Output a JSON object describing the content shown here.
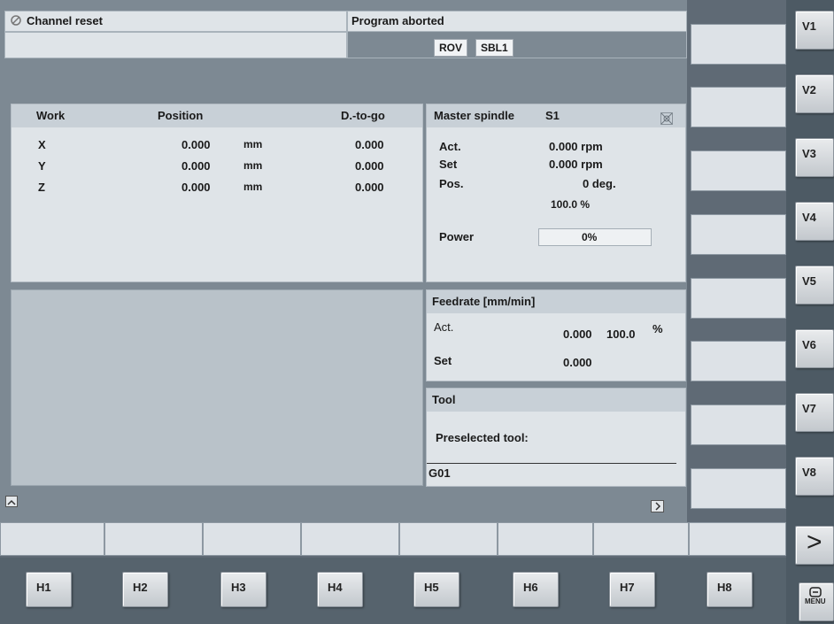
{
  "header": {
    "status": "Channel reset",
    "program_status": "Program aborted",
    "chips": [
      "ROV",
      "SBL1"
    ]
  },
  "work": {
    "headers": [
      "Work",
      "Position",
      "D.-to-go"
    ],
    "rows": [
      {
        "axis": "X",
        "pos": "0.000",
        "unit": "mm",
        "dtg": "0.000"
      },
      {
        "axis": "Y",
        "pos": "0.000",
        "unit": "mm",
        "dtg": "0.000"
      },
      {
        "axis": "Z",
        "pos": "0.000",
        "unit": "mm",
        "dtg": "0.000"
      }
    ]
  },
  "spindle": {
    "title": "Master spindle",
    "name": "S1",
    "act_label": "Act.",
    "act_value": "0.000 rpm",
    "set_label": "Set",
    "set_value": "0.000 rpm",
    "pos_label": "Pos.",
    "pos_value": "0 deg.",
    "override": "100.0 %",
    "power_label": "Power",
    "power_value": "0%"
  },
  "feed": {
    "title": "Feedrate [mm/min]",
    "act_label": "Act.",
    "act_value": "0.000",
    "act_override": "100.0",
    "percent": "%",
    "set_label": "Set",
    "set_value": "0.000"
  },
  "tool": {
    "title": "Tool",
    "preselected_label": "Preselected tool:",
    "gcode": "G01"
  },
  "keys": {
    "horizontal": [
      "H1",
      "H2",
      "H3",
      "H4",
      "H5",
      "H6",
      "H7",
      "H8"
    ],
    "vertical": [
      "V1",
      "V2",
      "V3",
      "V4",
      "V5",
      "V6",
      "V7",
      "V8"
    ],
    "next": ">",
    "menu": "MENU"
  }
}
